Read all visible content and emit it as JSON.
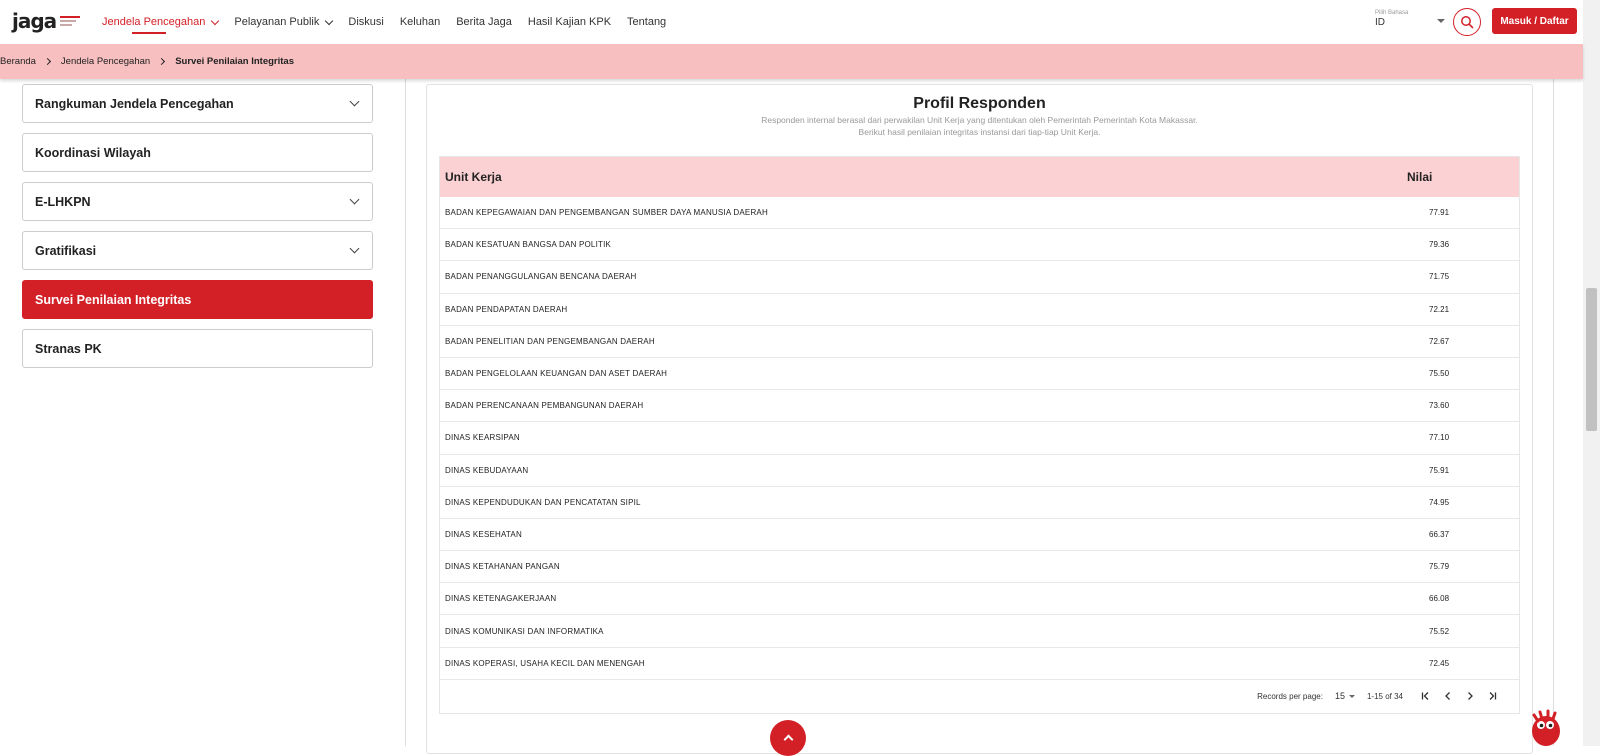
{
  "header": {
    "logo_text": "jaga",
    "nav": [
      {
        "label": "Jendela Pencegahan",
        "has_dropdown": true,
        "active": true
      },
      {
        "label": "Pelayanan Publik",
        "has_dropdown": true,
        "active": false
      },
      {
        "label": "Diskusi",
        "has_dropdown": false,
        "active": false
      },
      {
        "label": "Keluhan",
        "has_dropdown": false,
        "active": false
      },
      {
        "label": "Berita Jaga",
        "has_dropdown": false,
        "active": false
      },
      {
        "label": "Hasil Kajian KPK",
        "has_dropdown": false,
        "active": false
      },
      {
        "label": "Tentang",
        "has_dropdown": false,
        "active": false
      }
    ],
    "language": {
      "label": "Pilih Bahasa",
      "value": "ID"
    },
    "login_label": "Masuk / Daftar"
  },
  "breadcrumb": [
    "Beranda",
    "Jendela Pencegahan",
    "Survei Penilaian Integritas"
  ],
  "sidebar": {
    "items": [
      {
        "label": "Rangkuman Jendela Pencegahan",
        "has_chevron": true,
        "active": false
      },
      {
        "label": "Koordinasi Wilayah",
        "has_chevron": false,
        "active": false
      },
      {
        "label": "E-LHKPN",
        "has_chevron": true,
        "active": false
      },
      {
        "label": "Gratifikasi",
        "has_chevron": true,
        "active": false
      },
      {
        "label": "Survei Penilaian Integritas",
        "has_chevron": false,
        "active": true
      },
      {
        "label": "Stranas PK",
        "has_chevron": false,
        "active": false
      }
    ]
  },
  "main": {
    "title": "Profil Responden",
    "subtitle_1": "Responden internal berasal dari perwakilan Unit Kerja yang ditentukan oleh Pemerintah Pemerintah Kota Makassar.",
    "subtitle_2": "Berikut hasil penilaian integritas instansi dari tiap-tiap Unit Kerja.",
    "table": {
      "headers": {
        "unit": "Unit Kerja",
        "nilai": "Nilai"
      },
      "rows": [
        {
          "unit": "BADAN KEPEGAWAIAN DAN PENGEMBANGAN SUMBER DAYA MANUSIA DAERAH",
          "nilai": "77.91"
        },
        {
          "unit": "BADAN KESATUAN BANGSA DAN POLITIK",
          "nilai": "79.36"
        },
        {
          "unit": "BADAN PENANGGULANGAN BENCANA DAERAH",
          "nilai": "71.75"
        },
        {
          "unit": "BADAN PENDAPATAN DAERAH",
          "nilai": "72.21"
        },
        {
          "unit": "BADAN PENELITIAN DAN PENGEMBANGAN DAERAH",
          "nilai": "72.67"
        },
        {
          "unit": "BADAN PENGELOLAAN KEUANGAN DAN ASET DAERAH",
          "nilai": "75.50"
        },
        {
          "unit": "BADAN PERENCANAAN PEMBANGUNAN DAERAH",
          "nilai": "73.60"
        },
        {
          "unit": "DINAS KEARSIPAN",
          "nilai": "77.10"
        },
        {
          "unit": "DINAS KEBUDAYAAN",
          "nilai": "75.91"
        },
        {
          "unit": "DINAS KEPENDUDUKAN DAN PENCATATAN SIPIL",
          "nilai": "74.95"
        },
        {
          "unit": "DINAS KESEHATAN",
          "nilai": "66.37"
        },
        {
          "unit": "DINAS KETAHANAN PANGAN",
          "nilai": "75.79"
        },
        {
          "unit": "DINAS KETENAGAKERJAAN",
          "nilai": "66.08"
        },
        {
          "unit": "DINAS KOMUNIKASI DAN INFORMATIKA",
          "nilai": "75.52"
        },
        {
          "unit": "DINAS KOPERASI, USAHA KECIL DAN MENENGAH",
          "nilai": "72.45"
        }
      ]
    },
    "pagination": {
      "records_label": "Records per page:",
      "records_value": "15",
      "range": "1-15 of 34",
      "first_icon": "first-page-icon",
      "prev_icon": "chevron-left-icon",
      "next_icon": "chevron-right-icon",
      "last_icon": "last-page-icon"
    }
  },
  "colors": {
    "accent": "#d32027",
    "breadcrumb_bg": "#f7bfbf",
    "table_header_bg": "#fcd1d3"
  }
}
